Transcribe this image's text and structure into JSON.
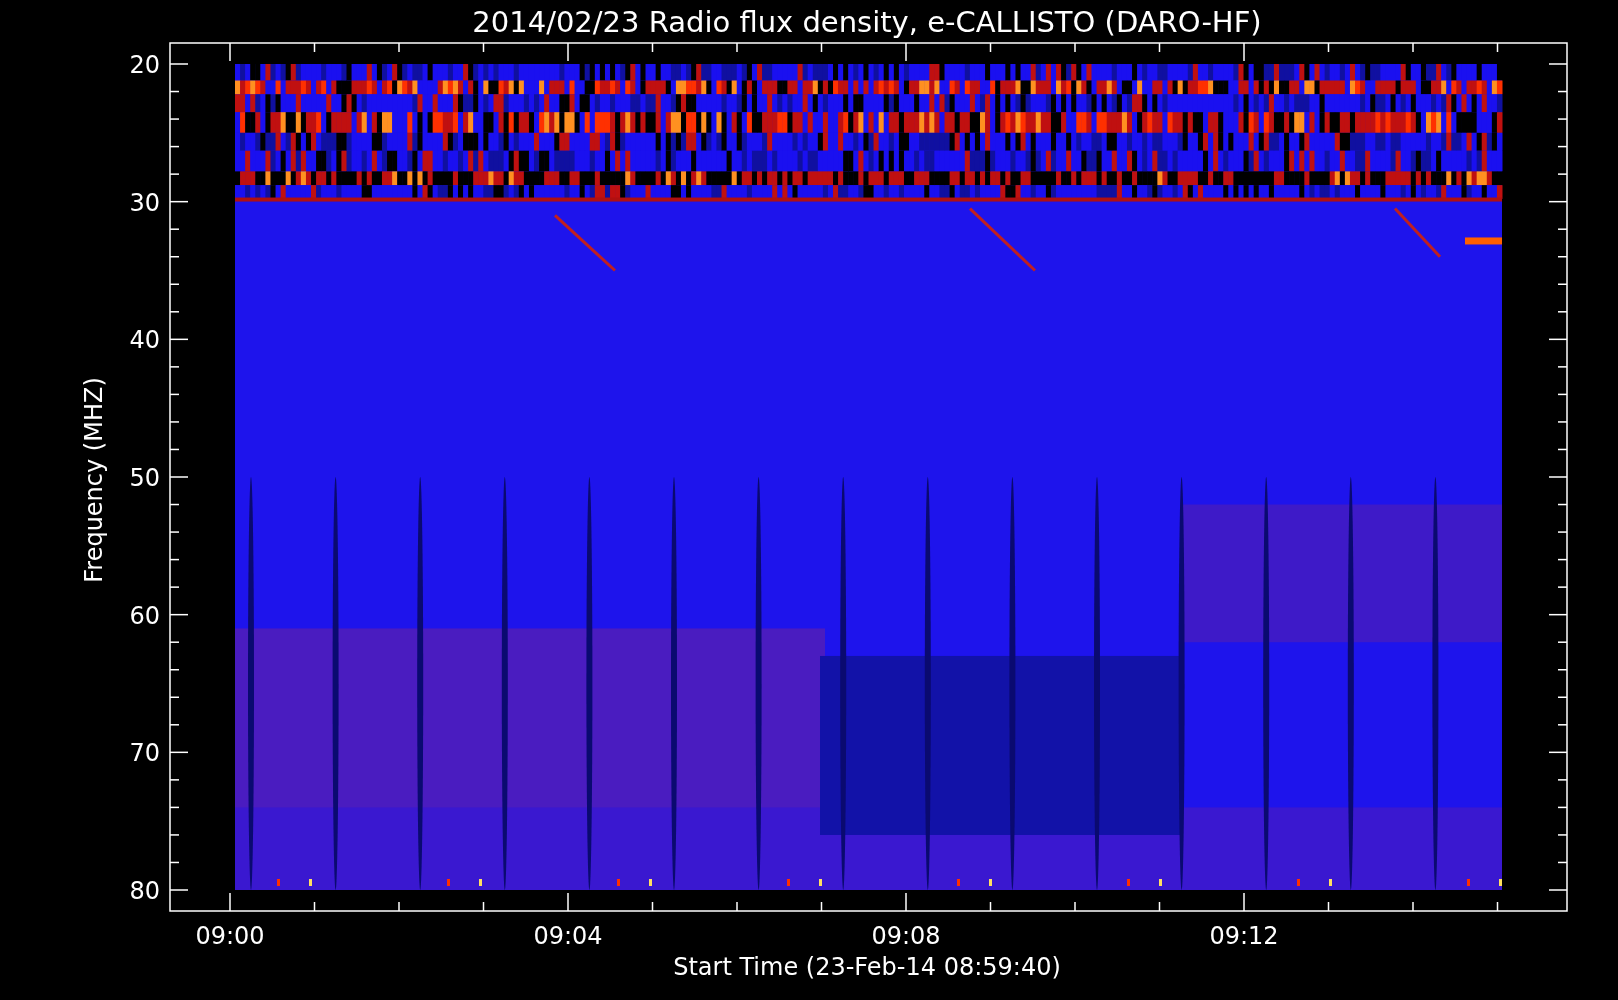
{
  "title": "2014/02/23  Radio flux density, e-CALLISTO (DARO-HF)",
  "y_axis": {
    "label": "Frequency (MHZ)",
    "ticks": [
      "20",
      "30",
      "40",
      "50",
      "60",
      "70",
      "80"
    ]
  },
  "x_axis": {
    "label": "Start Time (23-Feb-14 08:59:40)",
    "ticks": [
      "09:00",
      "09:04",
      "09:08",
      "09:12"
    ]
  }
}
